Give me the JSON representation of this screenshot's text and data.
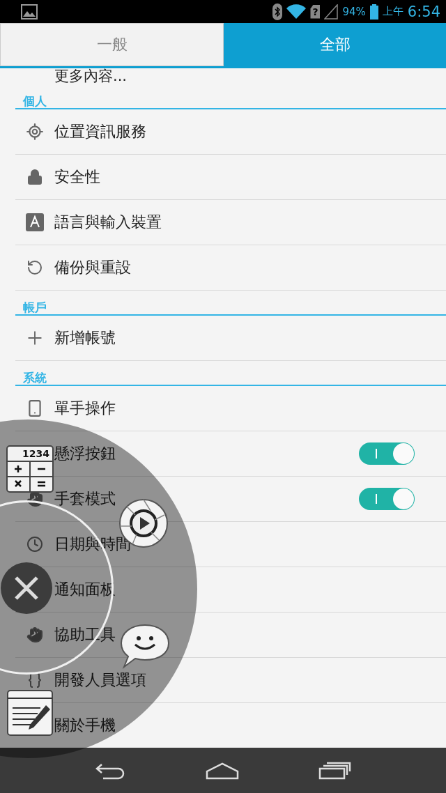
{
  "status_bar": {
    "sim_mark": "?",
    "battery": "94%",
    "period": "上午",
    "time": "6:54"
  },
  "tabs": [
    {
      "label": "一般",
      "selected": false
    },
    {
      "label": "全部",
      "selected": true
    }
  ],
  "partial_item": "更多內容...",
  "sections": [
    {
      "header": "個人",
      "items": [
        {
          "label": "位置資訊服務"
        },
        {
          "label": "安全性"
        },
        {
          "label": "語言與輸入裝置"
        },
        {
          "label": "備份與重設"
        }
      ]
    },
    {
      "header": "帳戶",
      "items": [
        {
          "label": "新增帳號"
        }
      ]
    },
    {
      "header": "系統",
      "items": [
        {
          "label": "單手操作"
        },
        {
          "label": "懸浮按鈕",
          "toggle": {
            "on": true
          }
        },
        {
          "label": "手套模式",
          "toggle": {
            "on": true
          }
        },
        {
          "label": "日期與時間"
        },
        {
          "label": "通知面板"
        },
        {
          "label": "協助工具"
        },
        {
          "label": "開發人員選項"
        },
        {
          "label": "關於手機"
        }
      ]
    }
  ],
  "floating_menu": {
    "calculator_display": "1234"
  }
}
